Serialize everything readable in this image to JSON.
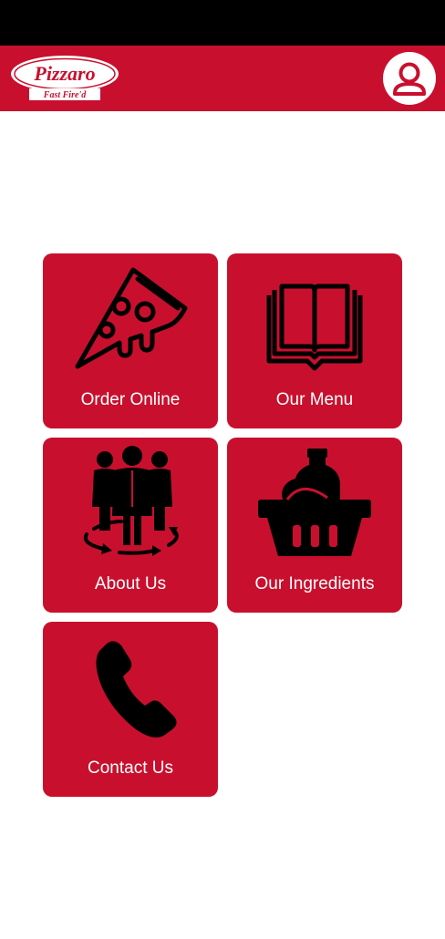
{
  "header": {
    "logo_text": "Pizzaro",
    "logo_tagline": "Fast Fire'd",
    "profile_icon": "user-avatar-icon"
  },
  "tiles": [
    {
      "label": "Order Online",
      "icon": "pizza-slice-icon"
    },
    {
      "label": "Our Menu",
      "icon": "open-book-icon"
    },
    {
      "label": "About Us",
      "icon": "team-icon"
    },
    {
      "label": "Our Ingredients",
      "icon": "basket-icon"
    },
    {
      "label": "Contact Us",
      "icon": "phone-icon"
    }
  ],
  "colors": {
    "brand_red": "#c8102e",
    "status_bar": "#000000",
    "background": "#ffffff",
    "tile_text": "#ffffff"
  }
}
